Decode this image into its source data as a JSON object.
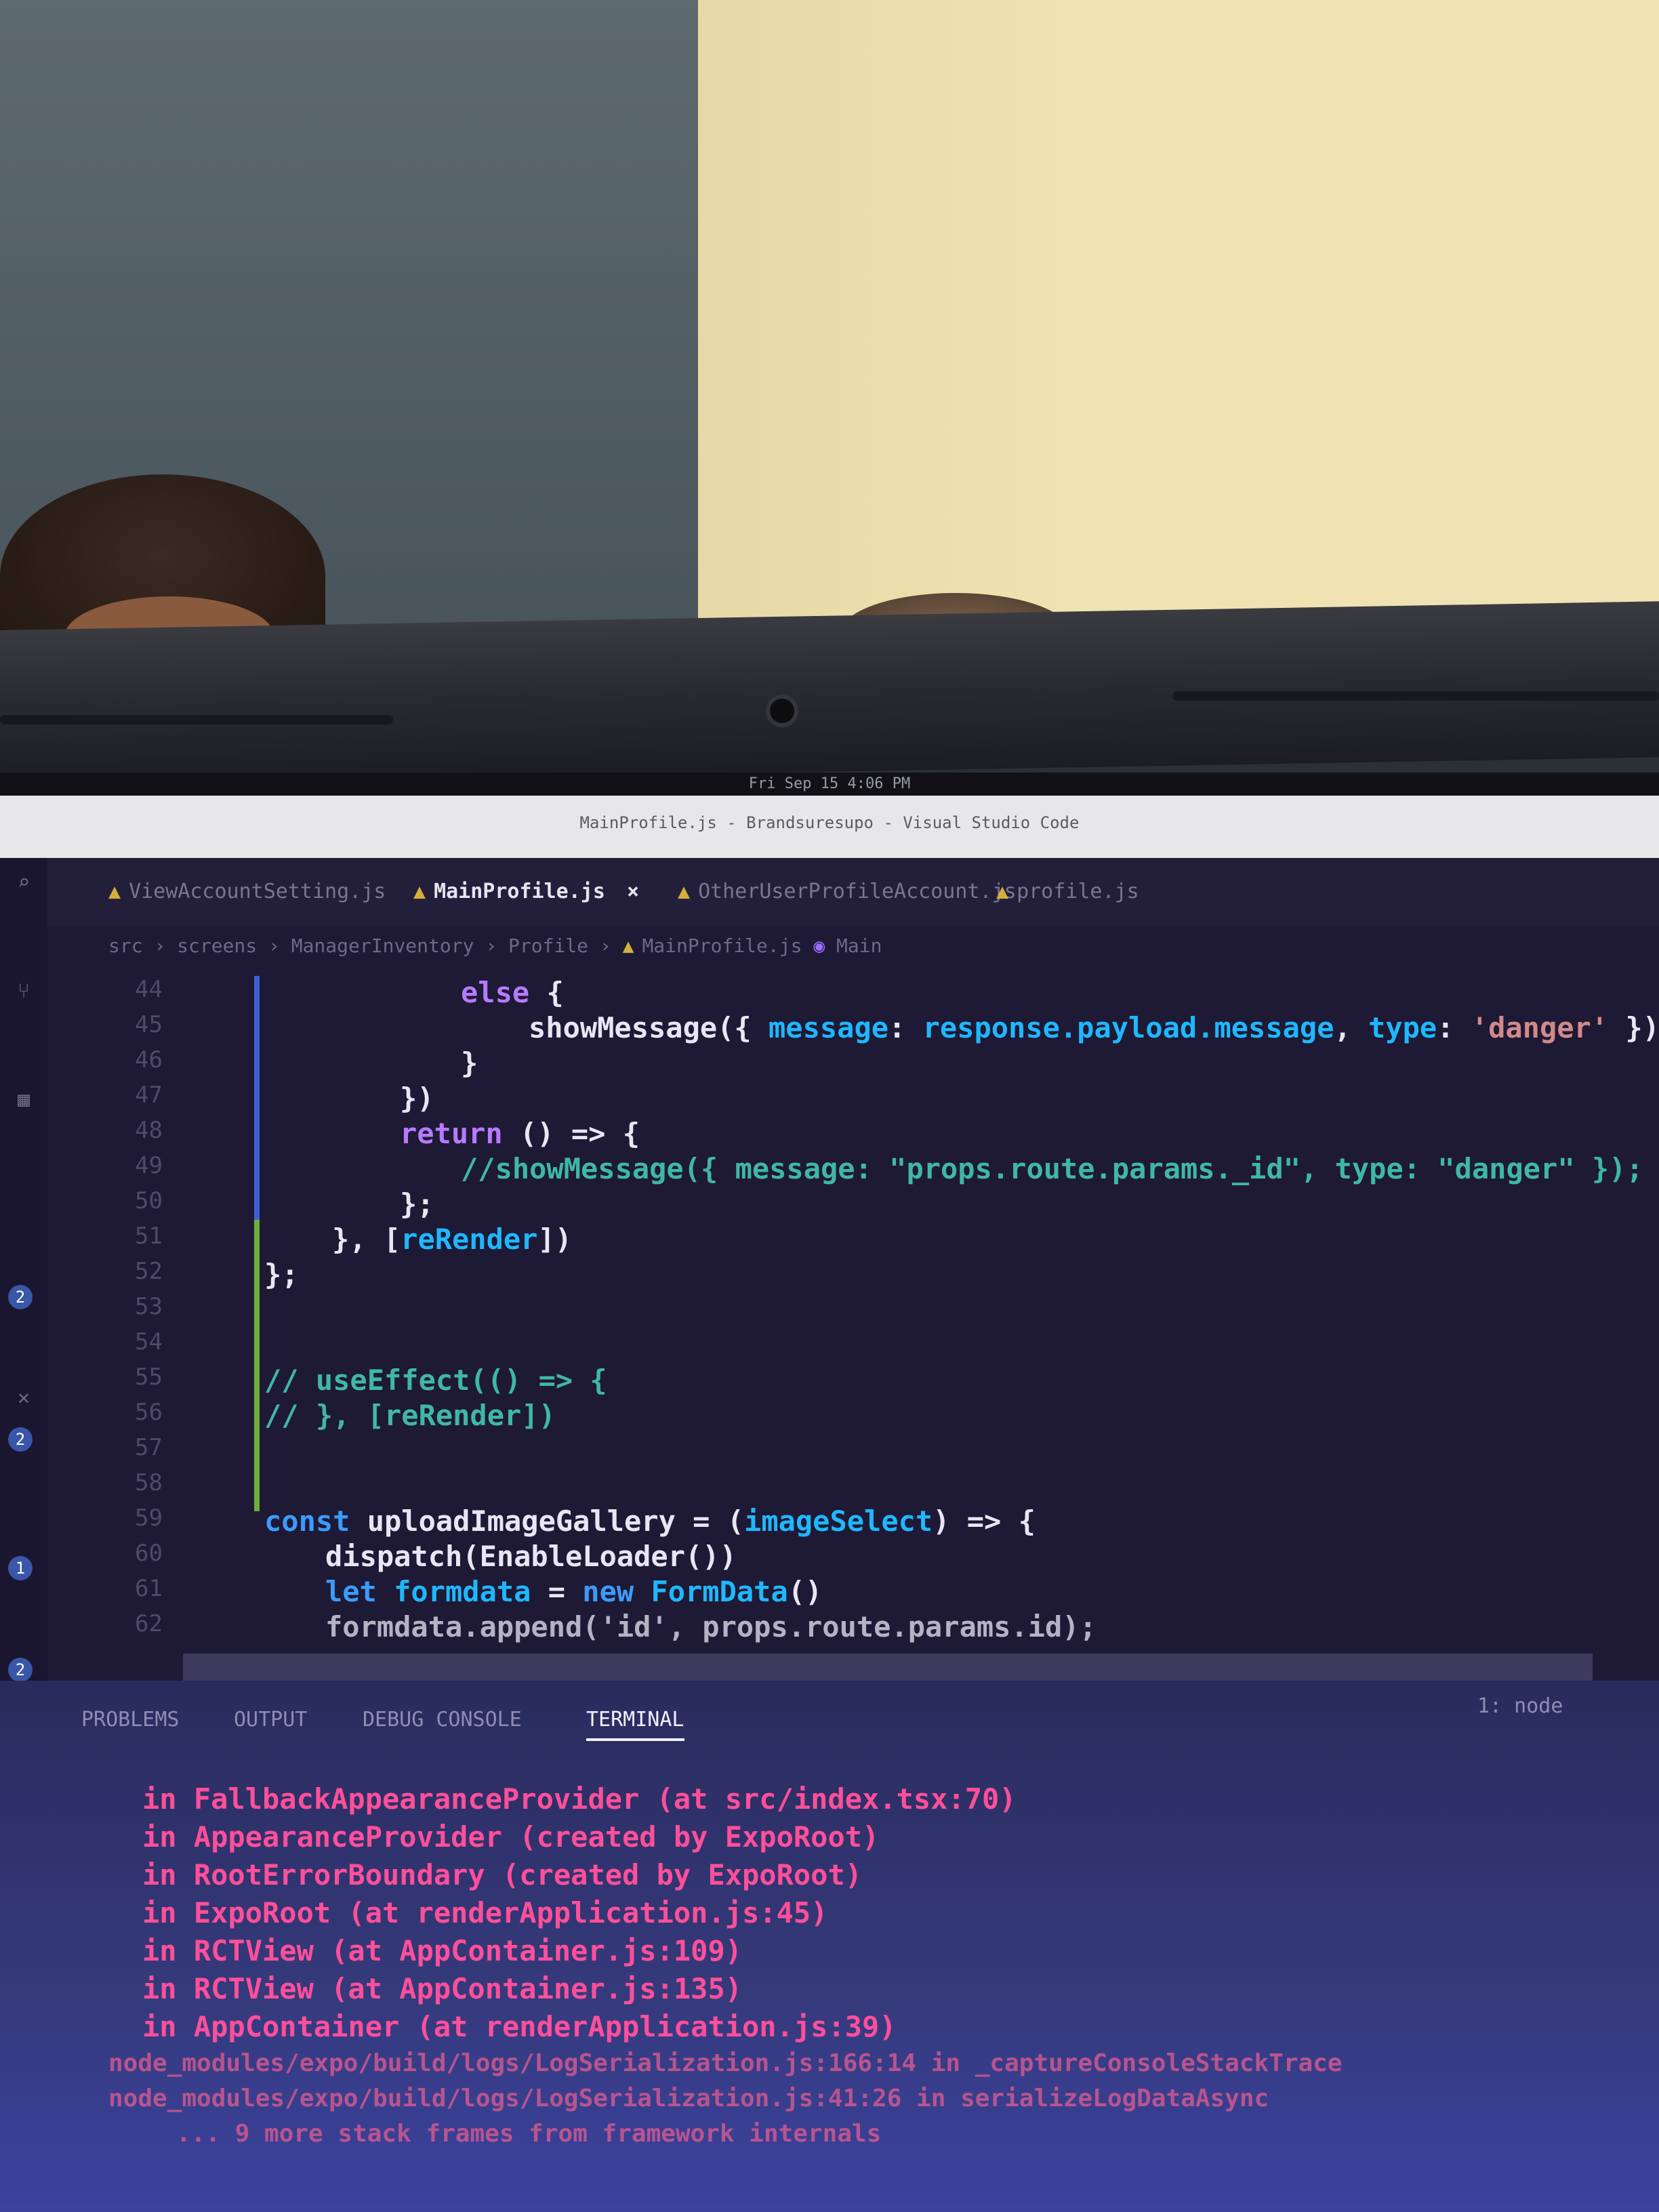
{
  "photo": {
    "background_left_color": "#55616a",
    "background_right_color": "#efe2b2"
  },
  "system_bar": {
    "clock": "Fri Sep 15  4:06 PM"
  },
  "window": {
    "title": "MainProfile.js - Brandsuresupo - Visual Studio Code"
  },
  "tabs": [
    {
      "label": "ViewAccountSetting.js",
      "active": false,
      "warning": true
    },
    {
      "label": "MainProfile.js",
      "active": true,
      "warning": true,
      "close": "×"
    },
    {
      "label": "OtherUserProfileAccount.js",
      "active": false,
      "warning": true
    },
    {
      "label": "profile.js",
      "active": false,
      "warning": true
    }
  ],
  "breadcrumb": {
    "text": "src › screens › ManagerInventory › Profile › ",
    "file": "MainProfile.js",
    "symbol": "Main"
  },
  "activity_badges": [
    "2",
    "2",
    "1",
    "2"
  ],
  "line_numbers": [
    "44",
    "45",
    "46",
    "47",
    "48",
    "49",
    "50",
    "51",
    "52",
    "53",
    "54",
    "55",
    "56",
    "57",
    "58",
    "59",
    "60",
    "61",
    "62"
  ],
  "code": {
    "l44_kw": "else",
    "l44_rest": " {",
    "l45_fn": "showMessage({ ",
    "l45_prop1": "message",
    "l45_colon": ": ",
    "l45_prop2": "response.payload.message",
    "l45_sep": ", ",
    "l45_prop3": "type",
    "l45_colon2": ": ",
    "l45_str": "'danger'",
    "l45_end": " });",
    "l46": "}",
    "l47": "})",
    "l48_kw": "return",
    "l48_rest": " () => {",
    "l49": "//showMessage({ message: \"props.route.params._id\", type: \"danger\" });",
    "l50": "};",
    "l51_start": "}, [",
    "l51_var": "reRender",
    "l51_end": "])",
    "l52": "};",
    "l55": "// useEffect(() => {",
    "l56": "// }, [reRender])",
    "l58_kw": "const",
    "l58_rest": " uploadImageGallery = (",
    "l58_param": "imageSelect",
    "l58_end": ") => {",
    "l59": "dispatch(EnableLoader())",
    "l60_kw": "let",
    "l60_var": " formdata",
    "l60_eq": " = ",
    "l60_new": "new",
    "l60_cls": " FormData",
    "l60_end": "()",
    "l61": "formdata.append('id', props.route.params.id);"
  },
  "panel": {
    "tabs": [
      "PROBLEMS",
      "OUTPUT",
      "DEBUG CONSOLE",
      "TERMINAL"
    ],
    "active_tab": "TERMINAL",
    "shell_label": "1: node",
    "terminal_lines": [
      "in FallbackAppearanceProvider (at src/index.tsx:70)",
      "in AppearanceProvider (created by ExpoRoot)",
      "in RootErrorBoundary (created by ExpoRoot)",
      "in ExpoRoot (at renderApplication.js:45)",
      "in RCTView (at AppContainer.js:109)",
      "in RCTView (at AppContainer.js:135)",
      "in AppContainer (at renderApplication.js:39)"
    ],
    "terminal_faded": [
      "node_modules/expo/build/logs/LogSerialization.js:166:14 in _captureConsoleStackTrace",
      "node_modules/expo/build/logs/LogSerialization.js:41:26 in serializeLogDataAsync",
      "... 9 more stack frames from framework internals"
    ]
  }
}
